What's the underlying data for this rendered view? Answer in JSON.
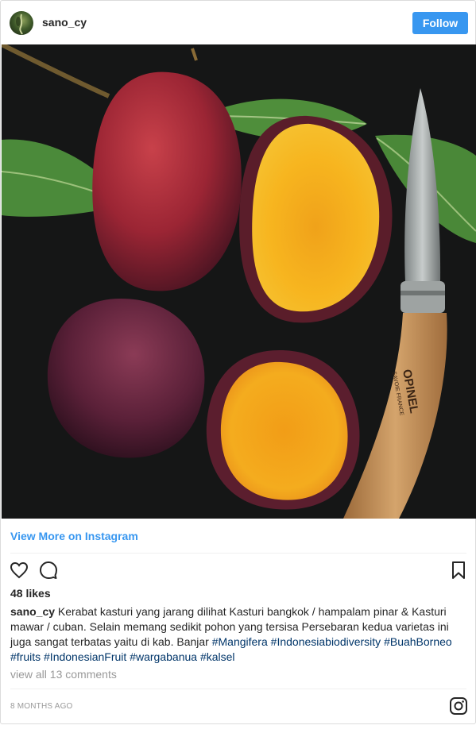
{
  "header": {
    "username": "sano_cy",
    "follow_label": "Follow"
  },
  "post": {
    "view_more_label": "View More on Instagram",
    "likes_text": "48 likes",
    "caption": {
      "username": "sano_cy",
      "text": " Kerabat kasturi yang jarang dilihat Kasturi bangkok / hampalam pinar & Kasturi mawar / cuban. Selain memang sedikit pohon yang tersisa Persebaran kedua varietas ini juga sangat terbatas yaitu di kab. Banjar ",
      "hashtags": [
        "#Mangifera",
        "#Indonesiabiodiversity",
        "#BuahBorneo",
        "#fruits",
        "#IndonesianFruit",
        "#wargabanua",
        "#kalsel"
      ]
    },
    "view_comments_label": "view all 13 comments",
    "timestamp": "8 MONTHS AGO",
    "knife_brand": "OPINEL",
    "knife_origin": "SAVOIE FRANCE"
  },
  "icons": {
    "like": "heart-outline",
    "comment": "speech-bubble-outline",
    "save": "bookmark-outline",
    "instagram": "instagram-logo"
  },
  "colors": {
    "accent": "#3897f0",
    "hashtag": "#003569",
    "muted": "#999999"
  }
}
